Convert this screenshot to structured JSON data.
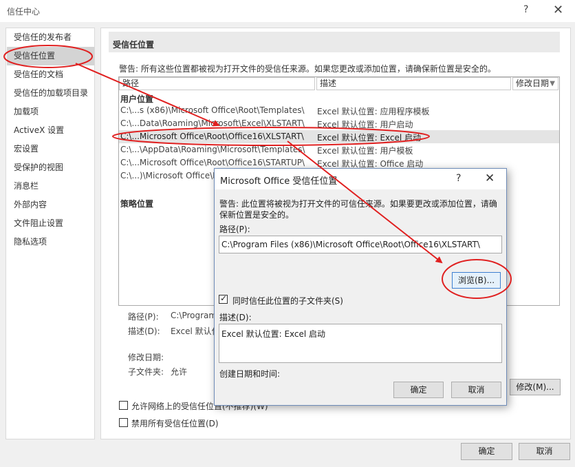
{
  "window": {
    "title": "信任中心",
    "help": "?",
    "close": "✕"
  },
  "sidebar": {
    "items": [
      {
        "label": "受信任的发布者"
      },
      {
        "label": "受信任位置"
      },
      {
        "label": "受信任的文档"
      },
      {
        "label": "受信任的加载项目录"
      },
      {
        "label": "加载项"
      },
      {
        "label": "ActiveX 设置"
      },
      {
        "label": "宏设置"
      },
      {
        "label": "受保护的视图"
      },
      {
        "label": "消息栏"
      },
      {
        "label": "外部内容"
      },
      {
        "label": "文件阻止设置"
      },
      {
        "label": "隐私选项"
      }
    ]
  },
  "main": {
    "section_title": "受信任位置",
    "warning": "警告: 所有这些位置都被视为打开文件的受信任来源。如果您更改或添加位置，请确保新位置是安全的。",
    "columns": {
      "path": "路径",
      "desc": "描述",
      "date": "修改日期",
      "sort_glyph": "▼"
    },
    "user_group": "用户位置",
    "policy_group": "策略位置",
    "rows": [
      {
        "path": "C:\\...s (x86)\\Microsoft Office\\Root\\Templates\\",
        "desc": "Excel 默认位置: 应用程序模板"
      },
      {
        "path": "C:\\...Data\\Roaming\\Microsoft\\Excel\\XLSTART\\",
        "desc": "Excel 默认位置: 用户启动"
      },
      {
        "path": "C:\\...Microsoft Office\\Root\\Office16\\XLSTART\\",
        "desc": "Excel 默认位置: Excel 启动"
      },
      {
        "path": "C:\\...\\AppData\\Roaming\\Microsoft\\Templates\\",
        "desc": "Excel 默认位置: 用户模板"
      },
      {
        "path": "C:\\...Microsoft Office\\Root\\Office16\\STARTUP\\",
        "desc": "Excel 默认位置: Office 启动"
      },
      {
        "path": "C:\\...)\\Microsoft Office\\R",
        "desc": ""
      }
    ],
    "details": {
      "path_label": "路径(P):",
      "path_value": "C:\\Program",
      "desc_label": "描述(D):",
      "desc_value": "Excel 默认位",
      "date_label": "修改日期:",
      "sub_label": "子文件夹:",
      "sub_value": "允许"
    },
    "modify_button": "修改(M)...",
    "allow_network": "允许网络上的受信任位置(不推荐)(W)",
    "disable_all": "禁用所有受信任位置(D)",
    "ok": "确定",
    "cancel": "取消"
  },
  "dialog": {
    "title": "Microsoft Office 受信任位置",
    "help": "?",
    "close": "✕",
    "warning_line1": "警告: 此位置将被视为打开文件的可信任来源。如果要更改或添加位置，请确",
    "warning_line2": "保新位置是安全的。",
    "path_label": "路径(P):",
    "path_value": "C:\\Program Files (x86)\\Microsoft Office\\Root\\Office16\\XLSTART\\",
    "browse": "浏览(B)...",
    "subfolders_label": "同时信任此位置的子文件夹(S)",
    "subfolders_checked": true,
    "desc_label": "描述(D):",
    "desc_value": "Excel 默认位置: Excel 启动",
    "created_label": "创建日期和时间:",
    "ok": "确定",
    "cancel": "取消"
  },
  "annotation_color": "#e02020"
}
